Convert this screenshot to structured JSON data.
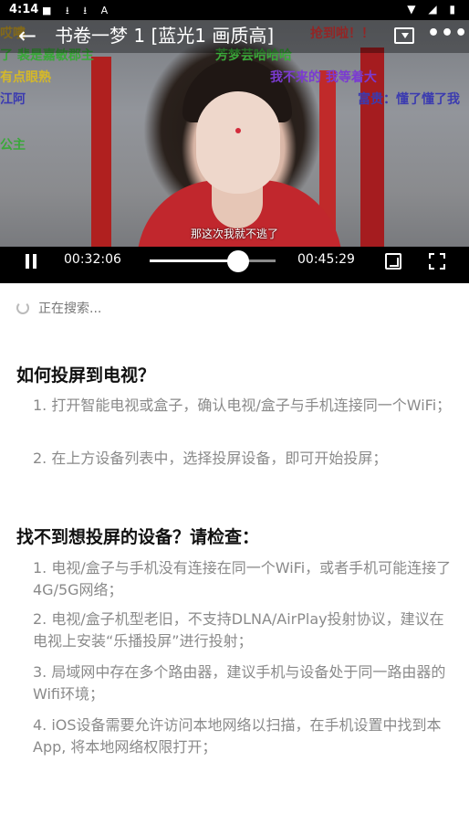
{
  "statusbar": {
    "time": "4:14",
    "left_icons": "■ ⭳ ⭳ A",
    "right_icons": "▼ ◢ ▮"
  },
  "player": {
    "title": "书卷一梦 1 [蓝光1 画质高]",
    "subtitle": "那这次我就不逃了",
    "current_time": "00:32:06",
    "total_time": "00:45:29",
    "progress": 0.7,
    "danmu": [
      {
        "text": "哎嘍",
        "color": "#c9a227"
      },
      {
        "text": "了 裴是嘉敏郡主",
        "color": "#3aa83a"
      },
      {
        "text": "有点眼熟",
        "color": "#d4b82a"
      },
      {
        "text": "江阿",
        "color": "#3b3bb0"
      },
      {
        "text": "公主",
        "color": "#3aa83a"
      },
      {
        "text": "抢到啦！！",
        "color": "#e23a3a"
      },
      {
        "text": "芳梦芸哈哈哈",
        "color": "#3aa83a"
      },
      {
        "text": "我不来的 我等着大",
        "color": "#7b3bd1"
      },
      {
        "text": "富贵：懂了懂了我",
        "color": "#3b3bb0"
      }
    ]
  },
  "search": {
    "status": "正在搜索..."
  },
  "help": {
    "how_title": "如何投屏到电视？",
    "how_steps": [
      "1. 打开智能电视或盒子，确认电视/盒子与手机连接同一个WiFi；",
      "2. 在上方设备列表中，选择投屏设备，即可开始投屏；"
    ],
    "check_title": "找不到想投屏的设备？请检查：",
    "check_steps": [
      "1. 电视/盒子与手机没有连接在同一个WiFi，或者手机可能连接了4G/5G网络；",
      "2. 电视/盒子机型老旧，不支持DLNA/AirPlay投射协议，建议在电视上安装“乐播投屏”进行投射；",
      "3. 局域网中存在多个路由器，建议手机与设备处于同一路由器的Wifi环境；",
      "4. iOS设备需要允许访问本地网络以扫描，在手机设置中找到本App, 将本地网络权限打开；"
    ]
  }
}
